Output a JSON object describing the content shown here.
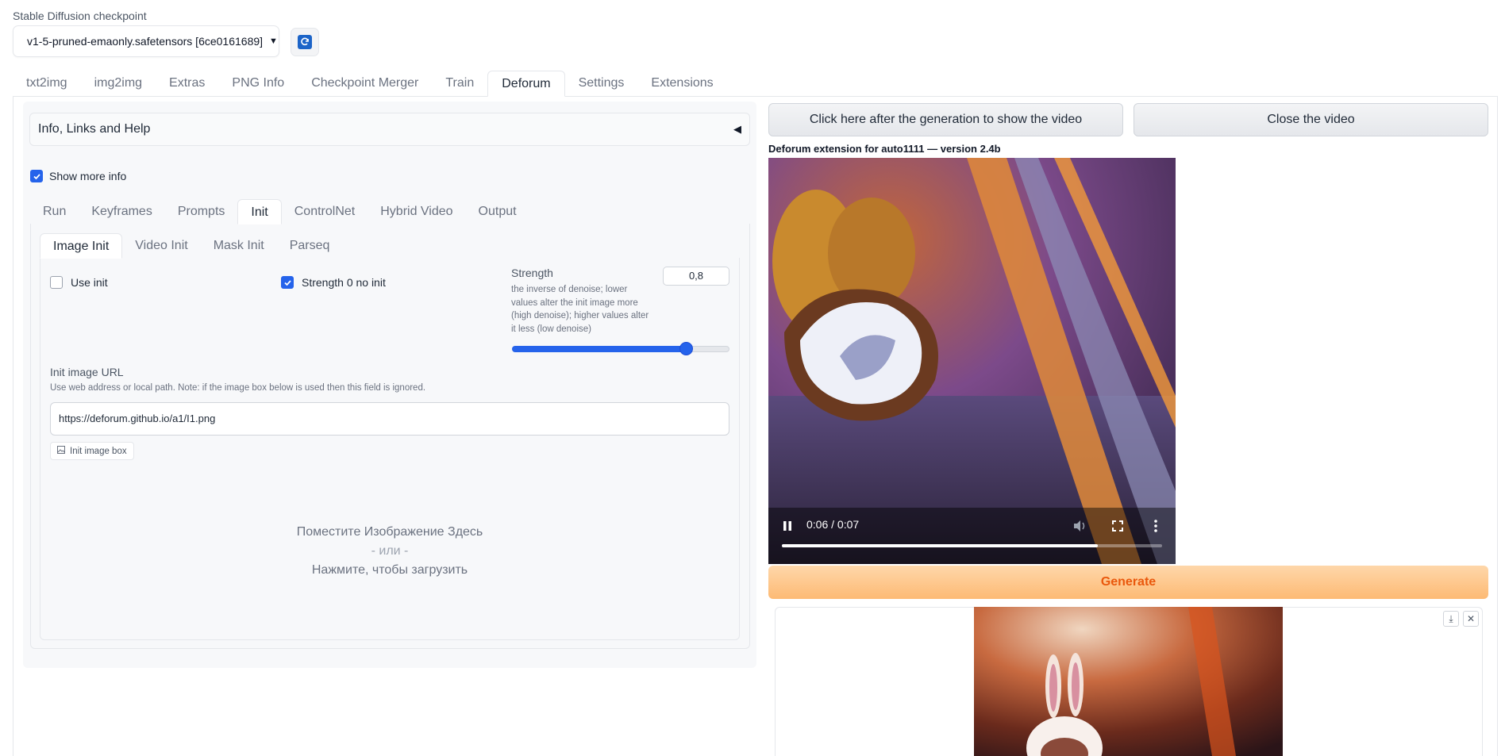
{
  "checkpoint": {
    "label": "Stable Diffusion checkpoint",
    "selected": "v1-5-pruned-emaonly.safetensors [6ce0161689]"
  },
  "main_tabs": [
    {
      "label": "txt2img"
    },
    {
      "label": "img2img"
    },
    {
      "label": "Extras"
    },
    {
      "label": "PNG Info"
    },
    {
      "label": "Checkpoint Merger"
    },
    {
      "label": "Train"
    },
    {
      "label": "Deforum",
      "active": true
    },
    {
      "label": "Settings"
    },
    {
      "label": "Extensions"
    }
  ],
  "accordion": {
    "label": "Info, Links and Help"
  },
  "show_more_info": {
    "label": "Show more info",
    "checked": true
  },
  "deforum_tabs": [
    {
      "label": "Run"
    },
    {
      "label": "Keyframes"
    },
    {
      "label": "Prompts"
    },
    {
      "label": "Init",
      "active": true
    },
    {
      "label": "ControlNet"
    },
    {
      "label": "Hybrid Video"
    },
    {
      "label": "Output"
    }
  ],
  "init_tabs": [
    {
      "label": "Image Init",
      "active": true
    },
    {
      "label": "Video Init"
    },
    {
      "label": "Mask Init"
    },
    {
      "label": "Parseq"
    }
  ],
  "use_init": {
    "label": "Use init",
    "checked": false
  },
  "strength_0_no_init": {
    "label": "Strength 0 no init",
    "checked": true
  },
  "strength": {
    "label": "Strength",
    "description": "the inverse of denoise; lower values alter the init image more (high denoise); higher values alter it less (low denoise)",
    "value": "0,8",
    "slider_fraction": 0.8
  },
  "init_image_url": {
    "label": "Init image URL",
    "hint": "Use web address or local path. Note: if the image box below is used then this field is ignored.",
    "value": "https://deforum.github.io/a1/I1.png"
  },
  "init_image_box": {
    "label": "Init image box",
    "drop_line1": "Поместите Изображение Здесь",
    "drop_or": "- или -",
    "drop_line2": "Нажмите, чтобы загрузить"
  },
  "video_buttons": {
    "show": "Click here after the generation to show the video",
    "close": "Close the video"
  },
  "version_text": "Deforum extension for auto1111 — version 2.4b",
  "video_player": {
    "time": "0:06 / 0:07",
    "progress_fraction": 0.83
  },
  "generate_label": "Generate",
  "colors": {
    "accent": "#2563eb",
    "generate_text": "#ea580c",
    "generate_bg": "#fdba74"
  }
}
